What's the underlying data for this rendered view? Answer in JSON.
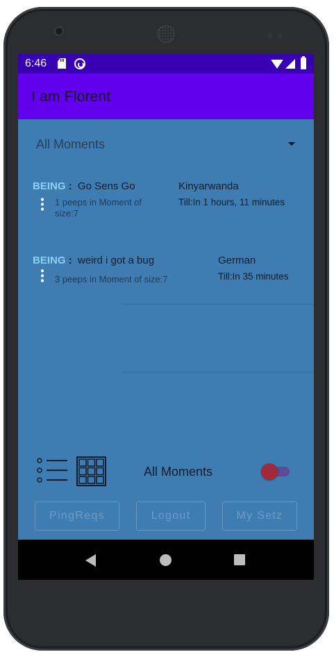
{
  "statusbar": {
    "time": "6:46",
    "icons": [
      "sd-card-icon",
      "sync-icon",
      "wifi-icon",
      "signal-icon",
      "battery-icon"
    ]
  },
  "appbar": {
    "title": "I am Florent"
  },
  "spinner": {
    "selected": "All Moments"
  },
  "moments": [
    {
      "tag": "BEING",
      "colon": ":",
      "title": "Go Sens Go",
      "peeps": "1 peeps in Moment of size:7",
      "language": "Kinyarwanda",
      "till": "Till:In 1 hours, 11 minutes"
    },
    {
      "tag": "BEING",
      "colon": ":",
      "title": "weird i got a bug",
      "peeps": "3 peeps in Moment of size:7",
      "language": "German",
      "till": "Till:In 35 minutes"
    }
  ],
  "bottom": {
    "label": "All Moments",
    "toggle_on": false
  },
  "buttons": {
    "ping": "PingReqs",
    "logout": "Logout",
    "setz": "My Setz"
  },
  "colors": {
    "status_bar": "#3700b3",
    "app_bar": "#6200ee",
    "background": "#3f7cb2",
    "being_tag": "#8ed0f5",
    "toggle_thumb": "#9e2a3a"
  }
}
